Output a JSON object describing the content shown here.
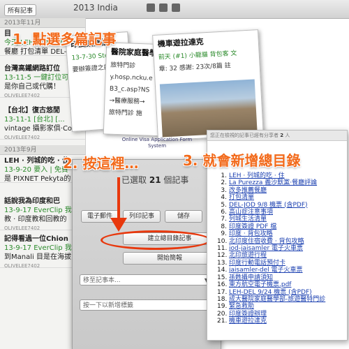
{
  "toolbar": {
    "all_notes_label": "所有記事",
    "notebook_title": "2013 India",
    "icons": [
      "pin-icon",
      "tag-icon",
      "share-icon"
    ]
  },
  "note_list": {
    "months": [
      "2013年11月",
      "2013年9月"
    ],
    "notes": [
      {
        "title": "目",
        "line1": "今天 LEH → 列城的吃 · 住",
        "line2": "餐廳 打包清單 DEL-"
      },
      {
        "title": "台灣高鐵網路訂位",
        "line1": "13-11-5 一鍵訂位可以",
        "line2": "是你自己或代購！",
        "author": "OLIVELEE7402"
      },
      {
        "title": "【台北】復古悠閒",
        "line1": "13-11-1 [台北] [...",
        "line2": "vintage 攝影家俱·Co",
        "author": "OLIVELEE7402"
      },
      {
        "title": "LEH · 列城的吃 · 住",
        "line1": "13-9-20 要入 | 免費",
        "line2": "是 PIXNET Pekyta的"
      },
      {
        "title": "話說我為印度和巴",
        "line1": "13-9-17 EverClip 我",
        "line2": "教 · 印度教和回教的",
        "author": "OLIVELEE7402"
      },
      {
        "title": "記得看過一位Chion",
        "line1": "13-9-17 EverClip 我",
        "line2": "到Manali 目是在海拔",
        "author": "OLIVELEE7402"
      }
    ]
  },
  "cards": {
    "back": {
      "title": "印度簽證辦",
      "line1": "13-7-30 Step",
      "line2": "要辦簽證之前"
    },
    "mid": {
      "title": "醫院家庭醫學",
      "line1": "旅特門診",
      "line2": "y.hosp.ncku.e",
      "line3": "B3_c.asp?NS",
      "line4": "→醫療服務→",
      "line5": "旅特門診 施"
    },
    "front": {
      "title": "機車遊拉達克",
      "line1": "前天 (#1) 小龍貓 背包客 文",
      "line2": "章: 32 感謝: 23次/8篇 註"
    },
    "visa": "Online Visa Application Form System"
  },
  "selection_panel": {
    "selected_prefix": "已選取",
    "selected_count": "21",
    "selected_suffix": "個記事",
    "email_button": "電子郵件",
    "print_button": "列印記事",
    "save_button": "儲存",
    "create_toc_button": "建立總目錄記事",
    "presentation_button": "開始簡報",
    "move_placeholder": "移至記事本...",
    "tag_placeholder": "按一下以新增標籤"
  },
  "toc_note": {
    "header_prefix": "您正在檢視的記事已經有分享者",
    "header_count": "2",
    "header_suffix": "人",
    "items": [
      "LEH · 列城的吃 · 住",
      "La Purezza 義沙默黨·餐廳評論",
      "改多推薦餐廳",
      "打包清單",
      "DEL-JOD 9/8 機票 (含PDF)",
      "高山症注意事項",
      "列城生活清單",
      "印度簽證 PDF 檔",
      "印度 · 背包攻略",
      "北印度住宿收費 · 背包攻略",
      "jod-jaisamler 電子火車票",
      "北印旅遊行程",
      "印度行動電話預付卡",
      "jaisamler-del 電子火車票",
      "孫甦攝申請須知",
      "東方航空電子機票.pdf",
      "LEH-DEL 9/24 機票 (含PDF)",
      "成大醫院家庭醫學部-旅遊醫特門診",
      "緊急救助",
      "印度簽證辦理",
      "機車遊拉達克"
    ]
  },
  "annotations": {
    "step1": "1. 點選多篇記事",
    "step2": "2. 按這裡…",
    "step3": "3. 就會新增總目錄"
  },
  "colors": {
    "annotation": "#f26a1b",
    "ellipse": "#e8380d",
    "link": "#1a3fb0",
    "date_green": "#2a8a2a"
  }
}
